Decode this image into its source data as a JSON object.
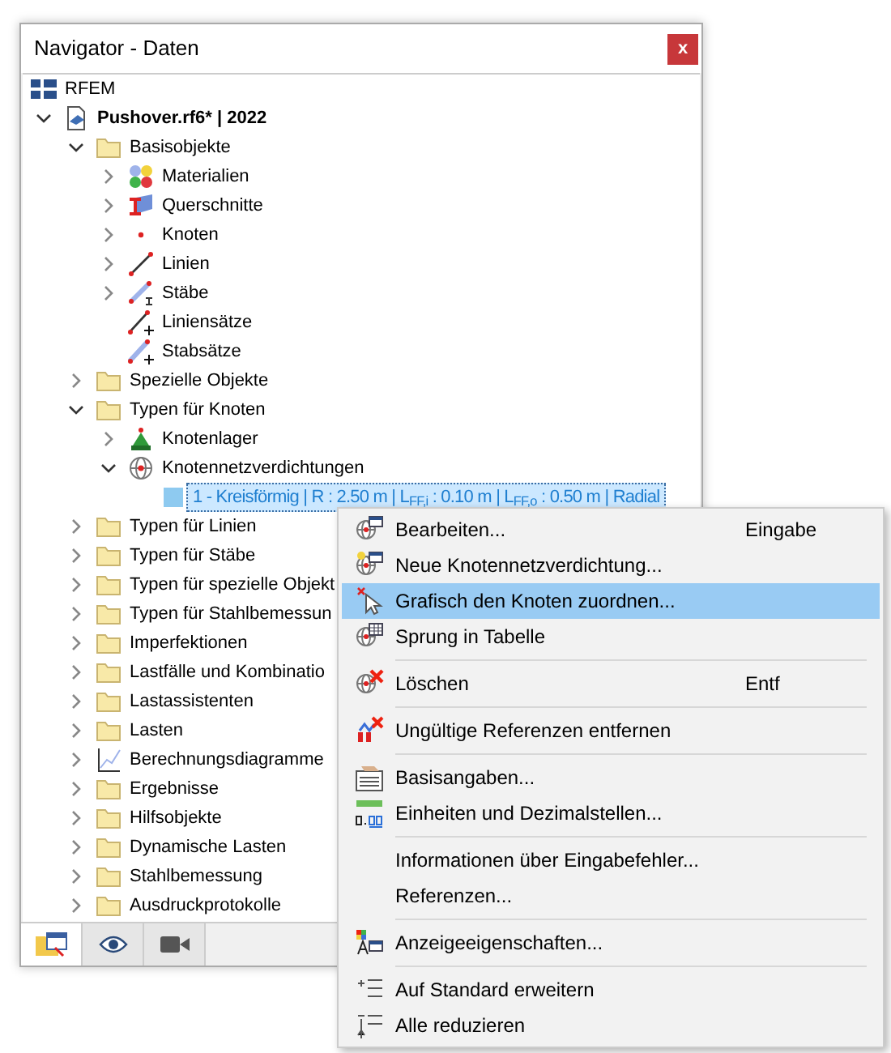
{
  "window": {
    "title": "Navigator - Daten",
    "close": "x"
  },
  "tree": [
    {
      "label": "RFEM",
      "kind": "app",
      "children": [
        {
          "label": "Pushover.rf6* | 2022",
          "kind": "file",
          "bold": true,
          "expanded": true,
          "children": [
            {
              "label": "Basisobjekte",
              "kind": "folder",
              "expanded": true,
              "children": [
                {
                  "label": "Materialien",
                  "kind": "material",
                  "expanded": false
                },
                {
                  "label": "Querschnitte",
                  "kind": "section",
                  "expanded": false
                },
                {
                  "label": "Knoten",
                  "kind": "node",
                  "expanded": false
                },
                {
                  "label": "Linien",
                  "kind": "line",
                  "expanded": false
                },
                {
                  "label": "Stäbe",
                  "kind": "member",
                  "expanded": false
                },
                {
                  "label": "Liniensätze",
                  "kind": "lineset"
                },
                {
                  "label": "Stabsätze",
                  "kind": "memberset"
                }
              ]
            },
            {
              "label": "Spezielle Objekte",
              "kind": "folder",
              "expanded": false
            },
            {
              "label": "Typen für Knoten",
              "kind": "folder",
              "expanded": true,
              "children": [
                {
                  "label": "Knotenlager",
                  "kind": "support",
                  "expanded": false
                },
                {
                  "label": "Knotennetzverdichtungen",
                  "kind": "mesh",
                  "expanded": true,
                  "children": [
                    {
                      "label": "1 - Kreisförmig | R : 2.50 m | L$_{FF,i}$ : 0.10 m | L$_{FF,o}$ : 0.50 m | Radial",
                      "kind": "swatch",
                      "selected": true
                    }
                  ]
                }
              ]
            },
            {
              "label": "Typen für Linien",
              "kind": "folder",
              "expanded": false
            },
            {
              "label": "Typen für Stäbe",
              "kind": "folder",
              "expanded": false
            },
            {
              "label": "Typen für spezielle Objekt",
              "kind": "folder",
              "expanded": false
            },
            {
              "label": "Typen für Stahlbemessun",
              "kind": "folder",
              "expanded": false
            },
            {
              "label": "Imperfektionen",
              "kind": "folder",
              "expanded": false
            },
            {
              "label": "Lastfälle und Kombinatio",
              "kind": "folder",
              "expanded": false
            },
            {
              "label": "Lastassistenten",
              "kind": "folder",
              "expanded": false
            },
            {
              "label": "Lasten",
              "kind": "folder",
              "expanded": false
            },
            {
              "label": "Berechnungsdiagramme",
              "kind": "diagram",
              "expanded": false
            },
            {
              "label": "Ergebnisse",
              "kind": "folder",
              "expanded": false
            },
            {
              "label": "Hilfsobjekte",
              "kind": "folder",
              "expanded": false
            },
            {
              "label": "Dynamische Lasten",
              "kind": "folder",
              "expanded": false
            },
            {
              "label": "Stahlbemessung",
              "kind": "folder",
              "expanded": false
            },
            {
              "label": "Ausdruckprotokolle",
              "kind": "folder",
              "expanded": false
            }
          ]
        }
      ]
    }
  ],
  "bottom_tabs": [
    {
      "kind": "navigator",
      "selected": true
    },
    {
      "kind": "view",
      "selected": false
    },
    {
      "kind": "camera",
      "selected": false
    }
  ],
  "context_menu": {
    "groups": [
      [
        {
          "label": "Bearbeiten...",
          "shortcut": "Eingabe",
          "kind": "edit",
          "selected": false
        },
        {
          "label": "Neue Knotennetzverdichtung...",
          "kind": "new",
          "selected": false
        },
        {
          "label": "Grafisch den Knoten zuordnen...",
          "kind": "pick",
          "selected": true
        },
        {
          "label": "Sprung in Tabelle",
          "kind": "table",
          "selected": false
        }
      ],
      [
        {
          "label": "Löschen",
          "shortcut": "Entf",
          "kind": "delete",
          "selected": false
        }
      ],
      [
        {
          "label": "Ungültige Referenzen entfernen",
          "kind": "refs",
          "selected": false
        }
      ],
      [
        {
          "label": "Basisangaben...",
          "kind": "basic",
          "selected": false
        },
        {
          "label": "Einheiten und Dezimalstellen...",
          "kind": "units",
          "selected": false
        }
      ],
      [
        {
          "label": "Informationen über Eingabefehler...",
          "kind": "none",
          "selected": false
        },
        {
          "label": "Referenzen...",
          "kind": "none",
          "selected": false
        }
      ],
      [
        {
          "label": "Anzeigeeigenschaften...",
          "kind": "display",
          "selected": false
        }
      ],
      [
        {
          "label": "Auf Standard erweitern",
          "kind": "expand",
          "selected": false
        },
        {
          "label": "Alle reduzieren",
          "kind": "collapse",
          "selected": false
        }
      ]
    ]
  }
}
